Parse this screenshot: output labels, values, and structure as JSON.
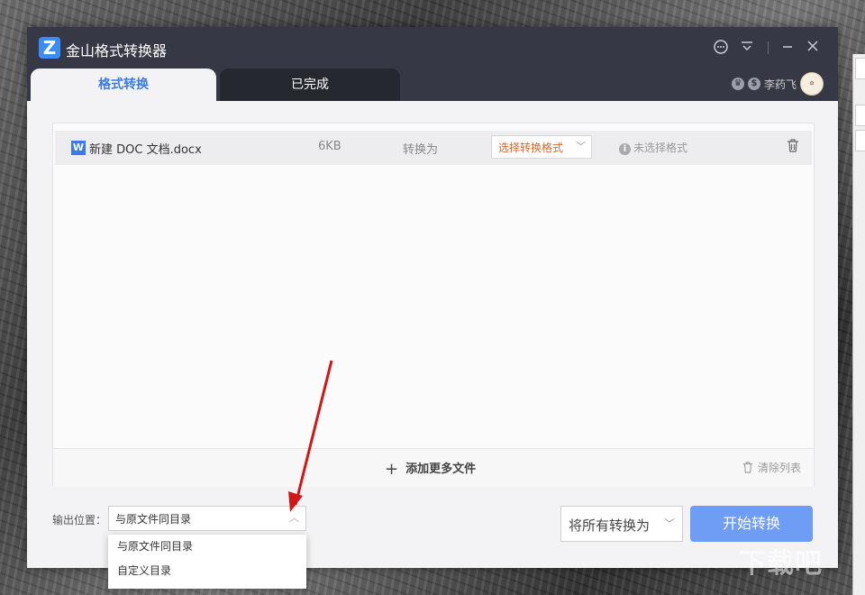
{
  "window": {
    "title": "金山格式转换器"
  },
  "tabs": [
    {
      "label": "格式转换",
      "active": true
    },
    {
      "label": "已完成",
      "active": false
    }
  ],
  "user": {
    "name": "李药飞"
  },
  "files": [
    {
      "name": "新建 DOC 文档.docx",
      "size": "6KB",
      "convert_label": "转换为",
      "format_placeholder": "选择转换格式",
      "status": "未选择格式"
    }
  ],
  "panel_footer": {
    "add_more": "添加更多文件",
    "clear_list": "清除列表"
  },
  "output": {
    "label": "输出位置：",
    "selected": "与原文件同目录",
    "options": [
      "与原文件同目录",
      "自定义目录"
    ]
  },
  "all_convert": {
    "label": "将所有转换为"
  },
  "start_button": {
    "label": "开始转换"
  },
  "colors": {
    "accent": "#3b7be6",
    "titlebar": "#363945",
    "start_button": "#6f9cf5",
    "format_placeholder": "#d8662a",
    "annotation_arrow": "#d01818"
  }
}
